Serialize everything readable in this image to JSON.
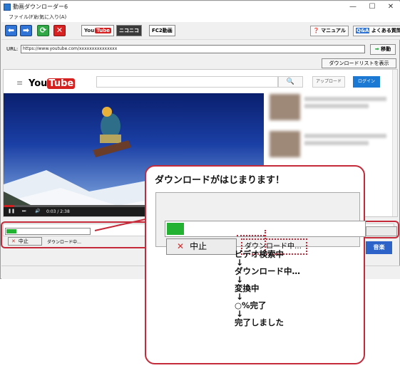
{
  "window": {
    "title": "動画ダウンローダー6",
    "controls": [
      "—",
      "☐",
      "✕"
    ]
  },
  "menu": {
    "file": "ファイル(F)",
    "favorites": "お気に入り(A)"
  },
  "toolbar": {
    "back_icon": "arrow-left-icon",
    "forward_icon": "arrow-right-icon",
    "refresh_icon": "refresh-icon",
    "stop_icon": "close-icon",
    "youtube_you": "You",
    "youtube_tube": "Tube",
    "niconico": "ニコニコ",
    "fc2": "FC2動画",
    "manual": "マニュアル",
    "faq": "よくある質問",
    "faq_icon": "Q&A"
  },
  "address": {
    "label": "URL:",
    "value": "https://www.youtube.com/xxxxxxxxxxxxxxx",
    "go": "移動"
  },
  "download_list_button": "ダウンロードリストを表示",
  "browser": {
    "logo_you": "You",
    "logo_tube": "Tube",
    "search_icon": "🔍",
    "upload": "アップロード",
    "login": "ログイン",
    "video_time": "0:03 / 2:38"
  },
  "mini_panel": {
    "stop": "中止",
    "status": "ダウンロード中…",
    "progress_fraction": 0.12
  },
  "music_button": "音楽",
  "callout": {
    "heading": "ダウンロードがはじまります！",
    "stop": "中止",
    "status": "ダウンロード中…",
    "steps": [
      "ビデオ検索中",
      "ダウンロード中…",
      "変換中",
      "○%完了",
      "完了しました"
    ],
    "arrow": "↓"
  },
  "colors": {
    "highlight": "#c42a3a",
    "progress": "#23b231",
    "accent_blue": "#2f74d6"
  }
}
